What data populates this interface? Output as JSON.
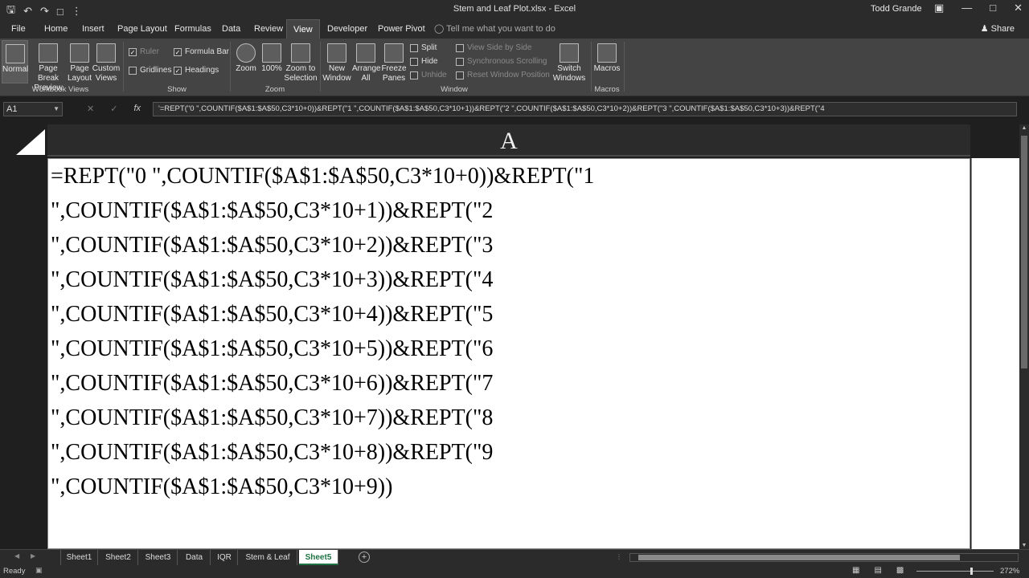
{
  "window": {
    "title": "Stem and Leaf Plot.xlsx - Excel",
    "user": "Todd Grande"
  },
  "tabs": [
    {
      "label": "File"
    },
    {
      "label": "Home"
    },
    {
      "label": "Insert"
    },
    {
      "label": "Page Layout"
    },
    {
      "label": "Formulas"
    },
    {
      "label": "Data"
    },
    {
      "label": "Review"
    },
    {
      "label": "View"
    },
    {
      "label": "Developer"
    },
    {
      "label": "Power Pivot"
    }
  ],
  "tell_me": "Tell me what you want to do",
  "share": "Share",
  "ribbon": {
    "workbook_views": {
      "group_label": "Workbook Views",
      "normal": "Normal",
      "page_break_preview": "Page Break Preview",
      "page_layout": "Page Layout",
      "custom_views": "Custom Views"
    },
    "show": {
      "group_label": "Show",
      "ruler": "Ruler",
      "formula_bar": "Formula Bar",
      "gridlines": "Gridlines",
      "headings": "Headings"
    },
    "zoom": {
      "group_label": "Zoom",
      "zoom": "Zoom",
      "hundred": "100%",
      "zoom_to_selection": "Zoom to Selection"
    },
    "window": {
      "group_label": "Window",
      "new_window": "New Window",
      "arrange_all": "Arrange All",
      "freeze_panes": "Freeze Panes",
      "split": "Split",
      "hide": "Hide",
      "unhide": "Unhide",
      "view_side_by_side": "View Side by Side",
      "synchronous_scrolling": "Synchronous Scrolling",
      "reset_window_position": "Reset Window Position",
      "switch_windows": "Switch Windows"
    },
    "macros": {
      "group_label": "Macros",
      "macros": "Macros"
    }
  },
  "formula_bar": {
    "name_box": "A1",
    "cancel": "✕",
    "enter": "✓",
    "fx": "fx",
    "content": "'=REPT(\"0 \",COUNTIF($A$1:$A$50,C3*10+0))&REPT(\"1 \",COUNTIF($A$1:$A$50,C3*10+1))&REPT(\"2 \",COUNTIF($A$1:$A$50,C3*10+2))&REPT(\"3 \",COUNTIF($A$1:$A$50,C3*10+3))&REPT(\"4"
  },
  "grid": {
    "column_header": "A",
    "cell_lines": [
      "=REPT(\"0 \",COUNTIF($A$1:$A$50,C3*10+0))&REPT(\"1",
      "\",COUNTIF($A$1:$A$50,C3*10+1))&REPT(\"2",
      "\",COUNTIF($A$1:$A$50,C3*10+2))&REPT(\"3",
      "\",COUNTIF($A$1:$A$50,C3*10+3))&REPT(\"4",
      "\",COUNTIF($A$1:$A$50,C3*10+4))&REPT(\"5",
      "\",COUNTIF($A$1:$A$50,C3*10+5))&REPT(\"6",
      "\",COUNTIF($A$1:$A$50,C3*10+6))&REPT(\"7",
      "\",COUNTIF($A$1:$A$50,C3*10+7))&REPT(\"8",
      "\",COUNTIF($A$1:$A$50,C3*10+8))&REPT(\"9",
      "\",COUNTIF($A$1:$A$50,C3*10+9))"
    ]
  },
  "sheet_tabs": [
    {
      "label": "Sheet1"
    },
    {
      "label": "Sheet2"
    },
    {
      "label": "Sheet3"
    },
    {
      "label": "Data"
    },
    {
      "label": "IQR"
    },
    {
      "label": "Stem & Leaf"
    },
    {
      "label": "Sheet5"
    }
  ],
  "status": {
    "ready": "Ready",
    "zoom": "272%"
  },
  "colors": {
    "accent": "#1f7244",
    "ribbon_bg": "#444444",
    "title_bg": "#2b2b2b"
  }
}
